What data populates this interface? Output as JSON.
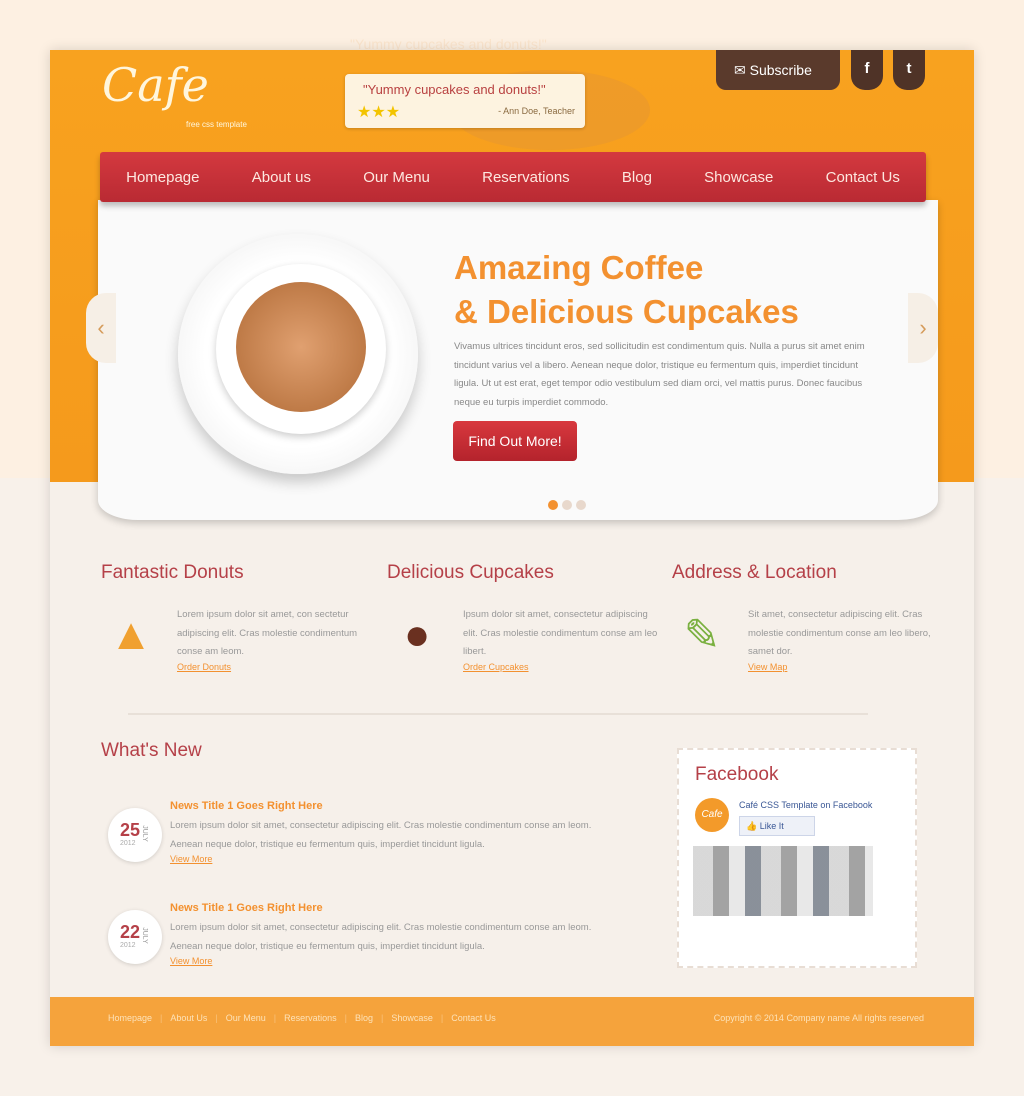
{
  "header": {
    "logo": "Cafe",
    "tagline": "free css template",
    "quote": "\"Yummy cupcakes and donuts!\"",
    "stars": "★★★",
    "rating": 3,
    "quote_author": "- Ann Doe, Teacher",
    "subscribe": "Subscribe",
    "facebook": "f",
    "twitter": "t"
  },
  "nav": [
    "Homepage",
    "About us",
    "Our Menu",
    "Reservations",
    "Blog",
    "Showcase",
    "Contact Us"
  ],
  "hero": {
    "title_line1": "Amazing Coffee",
    "title_line2": "& Delicious Cupcakes",
    "text": "Vivamus ultrices tincidunt eros, sed sollicitudin est condimentum quis. Nulla a purus sit amet enim tincidunt varius vel a libero. Aenean neque dolor, tristique eu fermentum quis, imperdiet tincidunt ligula. Ut ut est erat, eget tempor odio vestibulum sed diam orci, vel mattis purus. Donec faucibus neque eu turpis imperdiet commodo.",
    "button": "Find Out More!",
    "prev": "‹",
    "next": "›"
  },
  "features": [
    {
      "title": "Fantastic Donuts",
      "text": "Lorem ipsum dolor sit amet, con sectetur adipiscing elit. Cras molestie condimentum conse am leom.",
      "link": "Order Donuts"
    },
    {
      "title": "Delicious Cupcakes",
      "text": "Ipsum dolor sit amet, consectetur adipiscing elit. Cras molestie condimentum conse am leo libert.",
      "link": "Order Cupcakes"
    },
    {
      "title": "Address & Location",
      "text": "Sit amet, consectetur adipiscing elit. Cras molestie condimentum conse am leo libero, samet dor.",
      "link": "View Map"
    }
  ],
  "whats_new": {
    "title": "What's New",
    "items": [
      {
        "day": "25",
        "month": "JULY",
        "year": "2012",
        "title": "News Title 1 Goes Right Here",
        "text": "Lorem ipsum dolor sit amet, consectetur adipiscing elit. Cras molestie condimentum conse am leom. Aenean neque dolor, tristique eu fermentum quis, imperdiet tincidunt ligula.",
        "link": "View More"
      },
      {
        "day": "22",
        "month": "JULY",
        "year": "2012",
        "title": "News Title 1 Goes Right Here",
        "text": "Lorem ipsum dolor sit amet, consectetur adipiscing elit. Cras molestie condimentum conse am leom. Aenean neque dolor, tristique eu fermentum quis, imperdiet tincidunt ligula.",
        "link": "View More"
      }
    ]
  },
  "facebook": {
    "title": "Facebook",
    "page_name": "Café CSS Template on Facebook",
    "like": "Like It",
    "avatar": "Cafe"
  },
  "footer": {
    "links": [
      "Homepage",
      "About Us",
      "Our Menu",
      "Reservations",
      "Blog",
      "Showcase",
      "Contact Us"
    ],
    "copyright": "Copyright © 2014 Company name All rights reserved"
  },
  "colors": {
    "orange": "#f7a021",
    "red": "#c4303a",
    "brown": "#5a3a2c"
  }
}
